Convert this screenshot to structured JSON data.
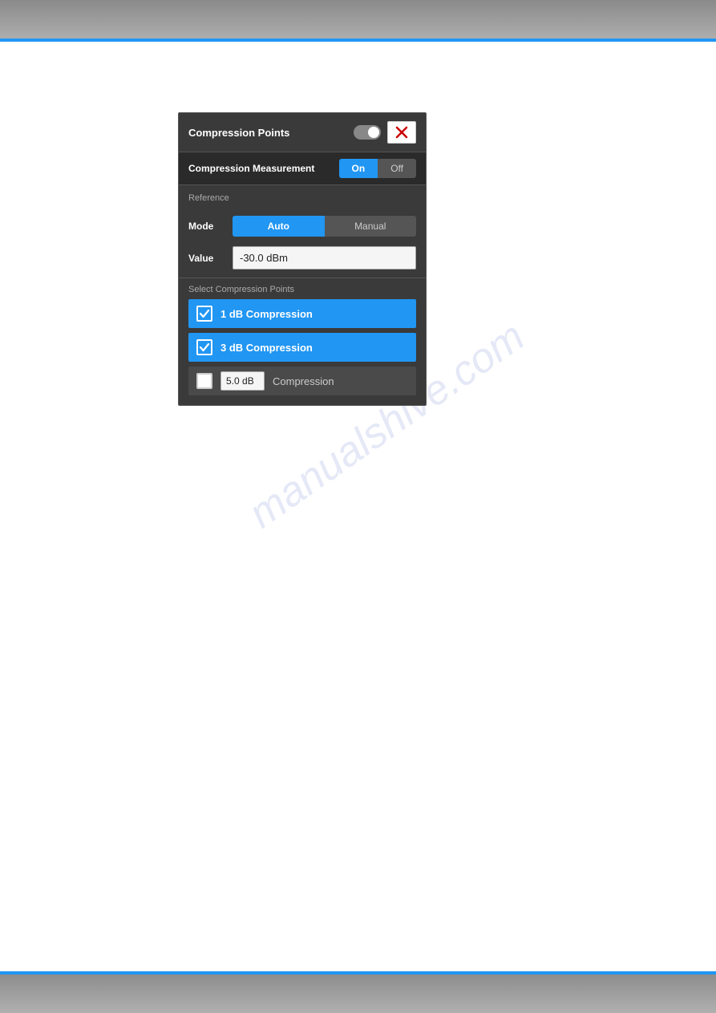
{
  "topBar": {
    "visible": true
  },
  "bottomBar": {
    "visible": true
  },
  "watermark": "manualshive.com",
  "dialog": {
    "title": "Compression Points",
    "closeButton": "×",
    "compressionMeasurement": {
      "label": "Compression Measurement",
      "onLabel": "On",
      "offLabel": "Off"
    },
    "reference": {
      "sectionLabel": "Reference",
      "mode": {
        "label": "Mode",
        "autoLabel": "Auto",
        "manualLabel": "Manual"
      },
      "value": {
        "label": "Value",
        "currentValue": "-30.0 dBm"
      }
    },
    "selectCompressionPoints": {
      "sectionLabel": "Select Compression Points",
      "items": [
        {
          "id": "1db",
          "label": "1 dB Compression",
          "checked": true
        },
        {
          "id": "3db",
          "label": "3 dB Compression",
          "checked": true
        }
      ],
      "customItem": {
        "value": "5.0 dB",
        "label": "Compression",
        "checked": false
      }
    }
  }
}
